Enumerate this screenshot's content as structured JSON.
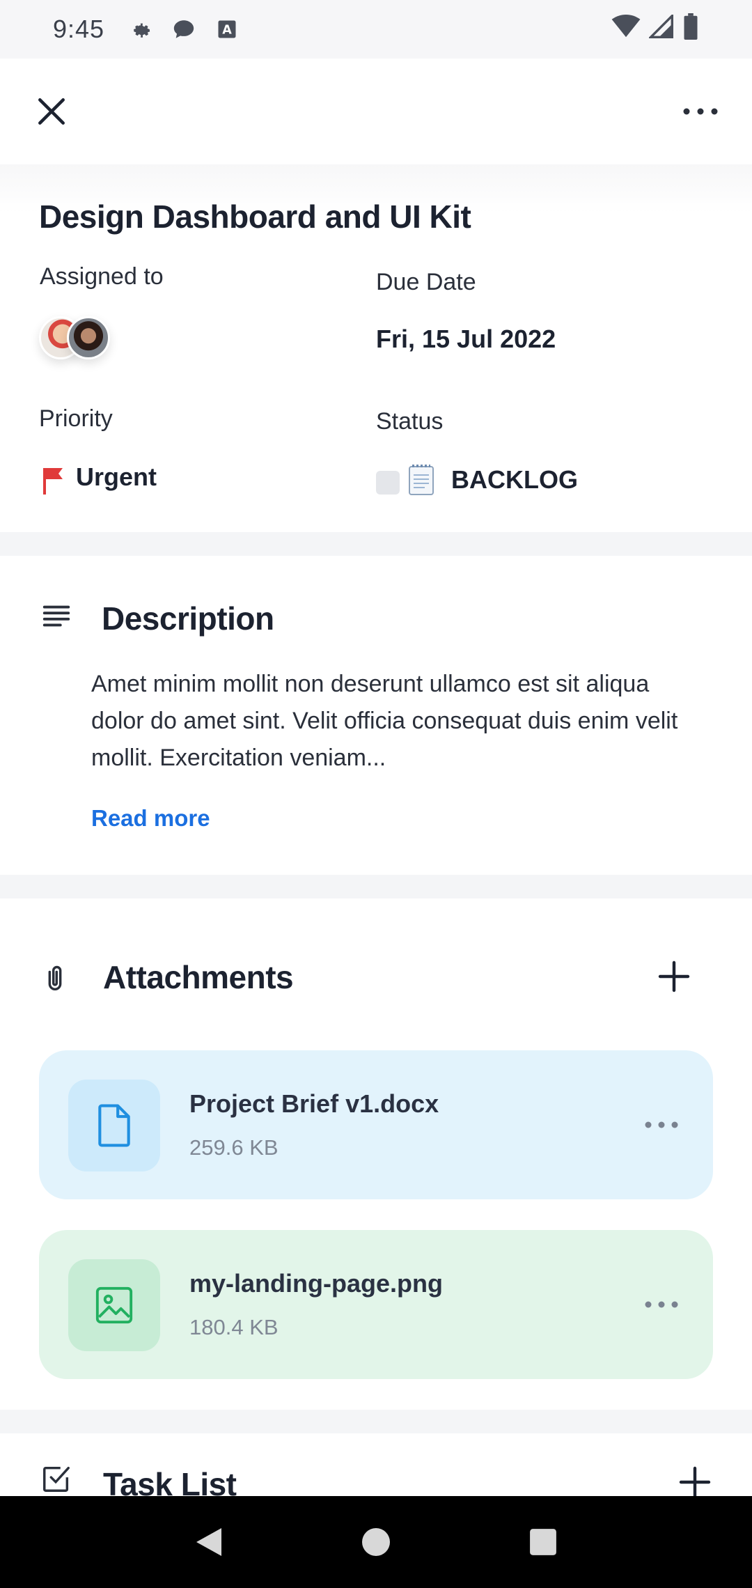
{
  "status_bar": {
    "time": "9:45"
  },
  "task": {
    "title": "Design Dashboard and UI Kit",
    "assigned_label": "Assigned to",
    "due_label": "Due Date",
    "due_value": "Fri, 15 Jul 2022",
    "priority_label": "Priority",
    "priority_value": "Urgent",
    "status_label": "Status",
    "status_value": "BACKLOG"
  },
  "description": {
    "title": "Description",
    "text": "Amet minim mollit non deserunt ullamco est sit aliqua dolor do amet sint. Velit officia consequat duis enim velit mollit. Exercitation veniam...",
    "read_more": "Read more"
  },
  "attachments": {
    "title": "Attachments",
    "files": [
      {
        "name": "Project Brief v1.docx",
        "size": "259.6 KB",
        "icon": "document-icon"
      },
      {
        "name": "my-landing-page.png",
        "size": "180.4 KB",
        "icon": "image-icon"
      }
    ]
  },
  "task_list": {
    "title": "Task List"
  },
  "colors": {
    "accent": "#1b6fe0",
    "urgent": "#e03a3a",
    "doc_bg": "#e2f3fc",
    "img_bg": "#e2f5e9"
  }
}
